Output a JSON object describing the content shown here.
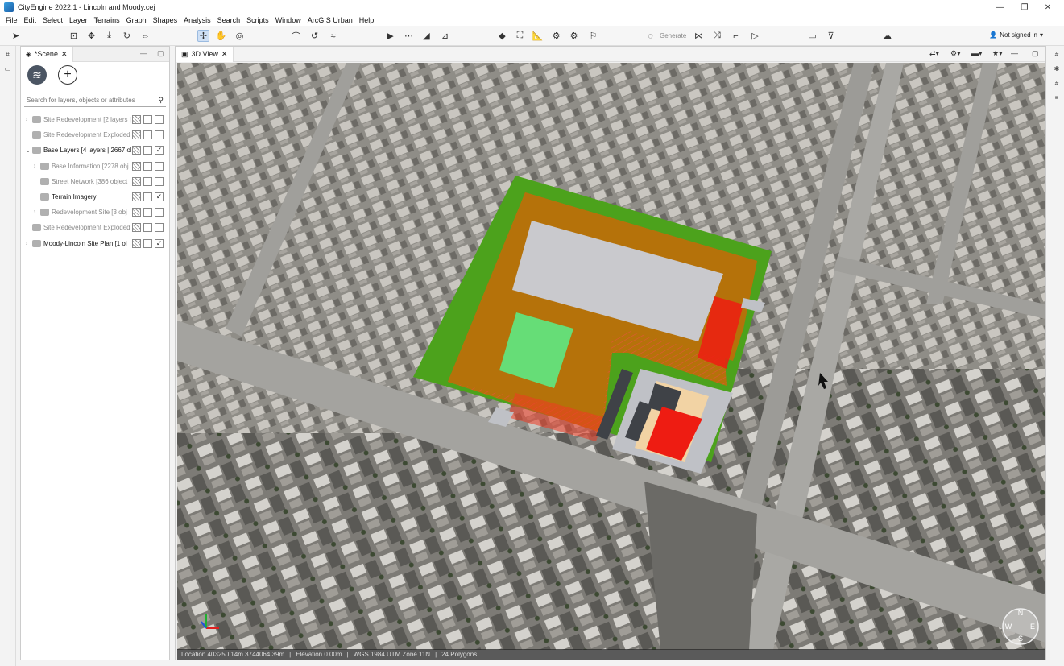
{
  "window": {
    "title": "CityEngine 2022.1 - Lincoln and Moody.cej"
  },
  "menu": [
    "File",
    "Edit",
    "Select",
    "Layer",
    "Terrains",
    "Graph",
    "Shapes",
    "Analysis",
    "Search",
    "Scripts",
    "Window",
    "ArcGIS Urban",
    "Help"
  ],
  "toolbar": {
    "generate_label": "Generate",
    "signin_label": "Not signed in"
  },
  "scene_panel": {
    "tab_label": "*Scene",
    "search_placeholder": "Search for layers, objects or attributes",
    "layers": [
      {
        "name": "Site Redevelopment [2 layers | 63",
        "indent": 0,
        "arrow": "›",
        "dim": true,
        "visible": false
      },
      {
        "name": "Site Redevelopment Exploded",
        "indent": 0,
        "arrow": "",
        "dim": true,
        "visible": false
      },
      {
        "name": "Base Layers [4 layers | 2667 ob",
        "indent": 0,
        "arrow": "⌄",
        "dim": false,
        "visible": true
      },
      {
        "name": "Base Information [2278 obj",
        "indent": 1,
        "arrow": "›",
        "dim": true,
        "visible": false
      },
      {
        "name": "Street Network [386 object",
        "indent": 1,
        "arrow": "",
        "dim": true,
        "visible": false
      },
      {
        "name": "Terrain Imagery",
        "indent": 1,
        "arrow": "",
        "dim": false,
        "visible": true
      },
      {
        "name": "Redevelopment Site [3 obj",
        "indent": 1,
        "arrow": "›",
        "dim": true,
        "visible": false
      },
      {
        "name": "Site Redevelopment Exploded",
        "indent": 0,
        "arrow": "",
        "dim": true,
        "visible": false
      },
      {
        "name": "Moody-Lincoln Site Plan [1 ol",
        "indent": 0,
        "arrow": "›",
        "dim": false,
        "visible": true
      }
    ]
  },
  "view_panel": {
    "tab_label": "3D View",
    "status": {
      "location": "Location 403250.14m 3744064.39m",
      "elevation": "Elevation 0.00m",
      "crs": "WGS 1984 UTM Zone 11N",
      "polygons": "24 Polygons"
    },
    "compass": {
      "n": "N",
      "e": "E",
      "s": "S",
      "w": "W"
    }
  },
  "colors": {
    "site_green": "#4ca21c",
    "site_orange": "#b5720a",
    "building_gray": "#c9c9cd",
    "plaza_green": "#66dd77",
    "roof_red": "#ee1c12",
    "street_light": "#bfc1c6",
    "sand": "#f2d3a4",
    "dark_building": "#3f4247"
  }
}
